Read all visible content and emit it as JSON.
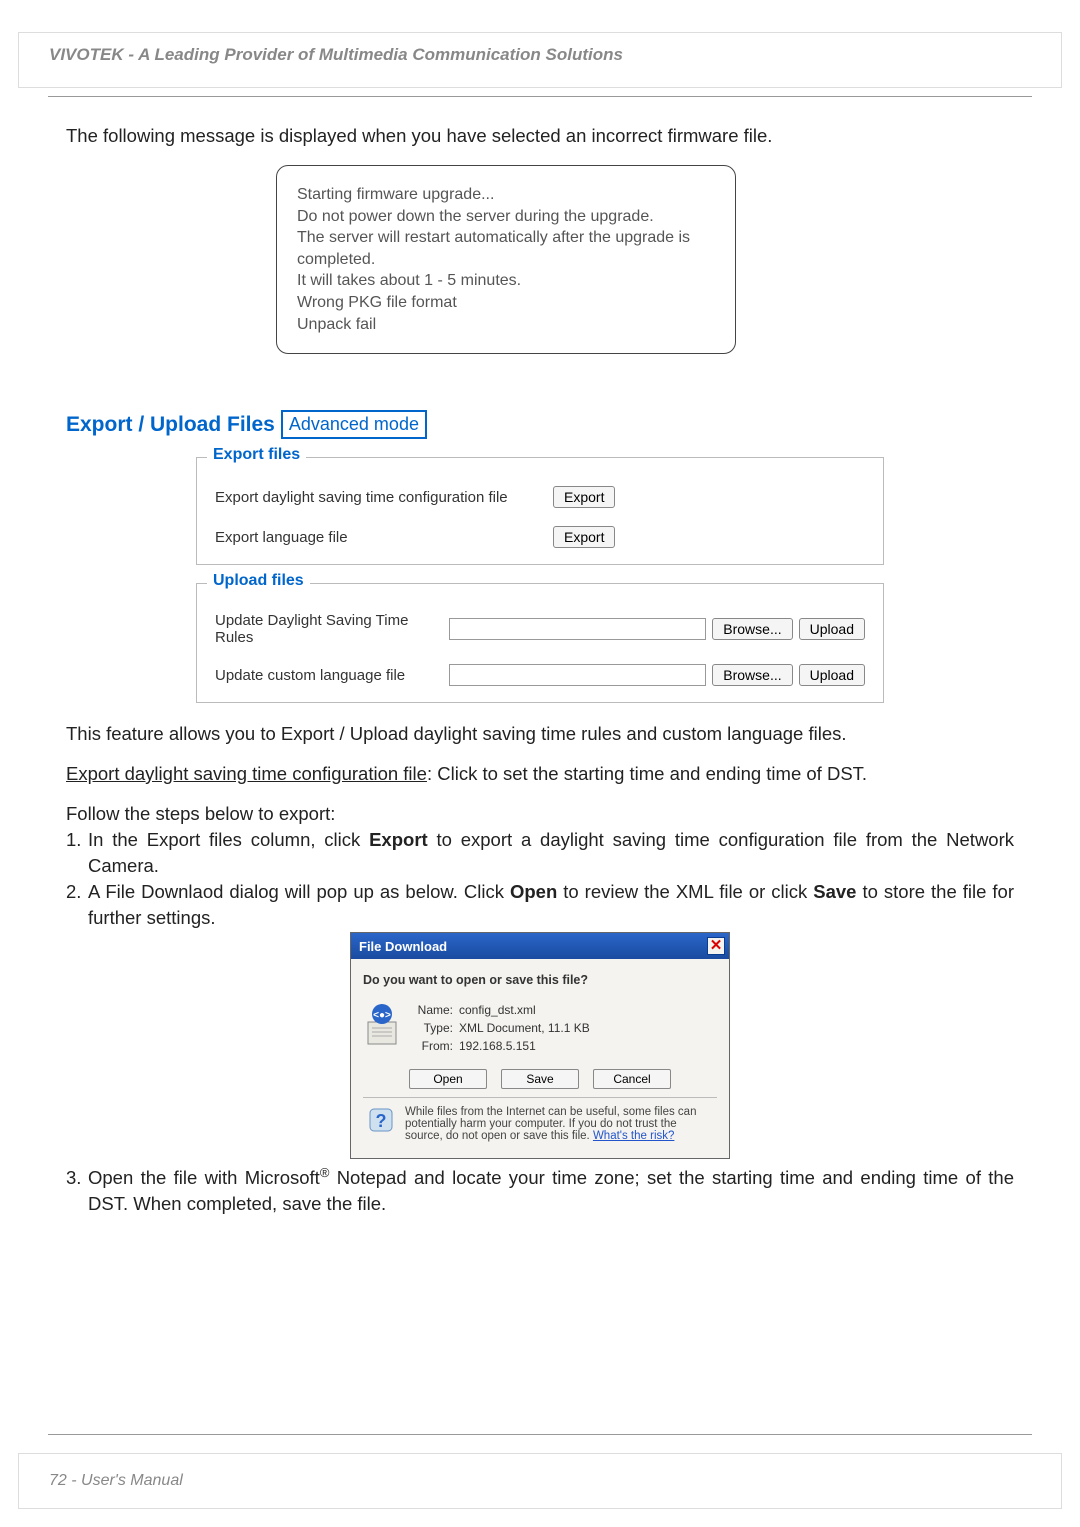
{
  "header": {
    "brand_line": "VIVOTEK - A Leading Provider of Multimedia Communication Solutions"
  },
  "intro": {
    "text": "The following message is displayed when you have selected an incorrect firmware file."
  },
  "message_box": {
    "line1": "Starting firmware upgrade...",
    "line2": "Do not power down the server during the upgrade.",
    "line3": "The server will restart automatically after the upgrade is completed.",
    "line4": "It will takes about 1 - 5 minutes.",
    "line5": "Wrong PKG file format",
    "line6": "Unpack fail"
  },
  "section": {
    "title": "Export / Upload Files",
    "badge": "Advanced mode"
  },
  "export_panel": {
    "legend": "Export files",
    "rows": [
      {
        "label": "Export daylight saving time configuration file",
        "button": "Export"
      },
      {
        "label": "Export language file",
        "button": "Export"
      }
    ]
  },
  "upload_panel": {
    "legend": "Upload files",
    "rows": [
      {
        "label": "Update Daylight Saving Time Rules",
        "browse": "Browse...",
        "upload": "Upload"
      },
      {
        "label": "Update custom language file",
        "browse": "Browse...",
        "upload": "Upload"
      }
    ]
  },
  "paras": {
    "p1": "This feature allows you to Export / Upload daylight saving time rules and custom language files.",
    "p2_underlined": "Export daylight saving time configuration file",
    "p2_rest": ": Click to set the starting time and ending time of DST.",
    "steps_intro": "Follow the steps below to export:",
    "step1_a": "In the Export files column, click ",
    "step1_bold": "Export",
    "step1_b": " to export a daylight saving time configuration file from the Network Camera.",
    "step2_a": "A File Downlaod dialog will pop up as below. Click ",
    "step2_bold1": "Open",
    "step2_b": " to review the XML file or click ",
    "step2_bold2": "Save",
    "step2_c": " to store the file for further settings.",
    "step3_a": "Open the file with Microsoft",
    "step3_sup": "®",
    "step3_b": " Notepad and locate your time zone; set the starting time and ending time of the DST. When completed, save the file."
  },
  "dialog": {
    "title": "File Download",
    "question": "Do you want to open or save this file?",
    "name_label": "Name:",
    "name": "config_dst.xml",
    "type_label": "Type:",
    "type": "XML Document, 11.1 KB",
    "from_label": "From:",
    "from": "192.168.5.151",
    "open": "Open",
    "save": "Save",
    "cancel": "Cancel",
    "warn_text": "While files from the Internet can be useful, some files can potentially harm your computer. If you do not trust the source, do not open or save this file. ",
    "warn_link": "What's the risk?"
  },
  "footer": {
    "text": "72 - User's Manual"
  }
}
